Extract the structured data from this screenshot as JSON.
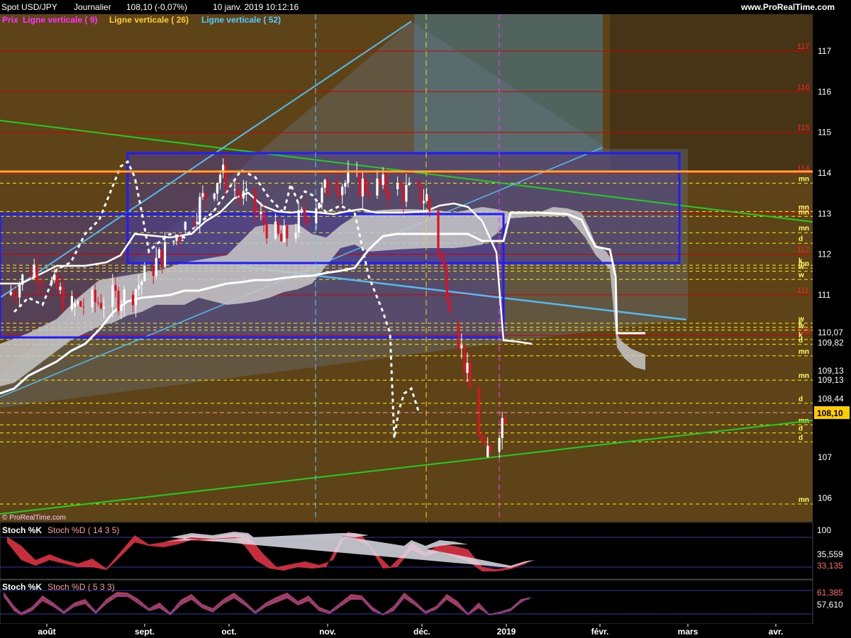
{
  "header": {
    "instrument": "Spot USD/JPY",
    "timeframe": "Journalier",
    "last_price": "108,10 (-0,07%)",
    "datetime": "10 janv. 2019 10:12:16",
    "site": "www.ProRealTime.com"
  },
  "legend": [
    {
      "label": "Prix",
      "color": "#ff33ff"
    },
    {
      "label": "Ligne verticale ( 9)",
      "color": "#ff33ff"
    },
    {
      "label": "Ligne verticale ( 26)",
      "color": "#ffcc33"
    },
    {
      "label": "Ligne verticale ( 52)",
      "color": "#55ccff"
    }
  ],
  "watermark": "© ProRealTime.com",
  "colors": {
    "background": "#000000",
    "chart_area": "#5e4318",
    "up_candle": "#ffffff",
    "down_candle": "#dd1122",
    "kumo": "#c8c8c8",
    "box": "#1d1dff",
    "trend_green": "#22cc22",
    "trend_blue": "#55bbee",
    "level_red": "#cc0000",
    "level_yellow": "#ffee00",
    "price_tag": "#ffcc00"
  },
  "chart_data": [
    {
      "type": "candlestick",
      "x_axis_labels": [
        "août",
        "sept.",
        "oct.",
        "nov.",
        "déc.",
        "2019",
        "févr.",
        "mars",
        "avr."
      ],
      "y_ticks": [
        {
          "label": "117",
          "value": 117
        },
        {
          "label": "116",
          "value": 116
        },
        {
          "label": "115",
          "value": 115
        },
        {
          "label": "114",
          "value": 114
        },
        {
          "label": "113",
          "value": 113
        },
        {
          "label": "112",
          "value": 112
        },
        {
          "label": "111",
          "value": 111
        },
        {
          "label": "110,07",
          "value": 110.07
        },
        {
          "label": "109,82",
          "value": 109.82
        },
        {
          "label": "109,13",
          "value": 109.13
        },
        {
          "label": "109,13",
          "value": 108.9
        },
        {
          "label": "108,44",
          "value": 108.44
        },
        {
          "label": "107",
          "value": 107
        },
        {
          "label": "106",
          "value": 106
        }
      ],
      "last_price": {
        "label": "108,10",
        "value": 108.1
      },
      "ylim": [
        105.6,
        117.9
      ],
      "red_levels": [
        {
          "value": 117,
          "label": "117"
        },
        {
          "value": 116,
          "label": "116"
        },
        {
          "value": 115,
          "label": "115"
        },
        {
          "value": 114,
          "label": "114"
        },
        {
          "value": 113,
          "label": "113"
        },
        {
          "value": 112,
          "label": "112"
        },
        {
          "value": 111,
          "label": "111"
        },
        {
          "value": 110,
          "label": "110"
        }
      ],
      "yellow_levels": [
        {
          "value": 113.75,
          "label": "mn"
        },
        {
          "value": 113.05,
          "label": "mn"
        },
        {
          "value": 112.93,
          "label": "mn"
        },
        {
          "value": 112.53,
          "label": "mn"
        },
        {
          "value": 112.27,
          "label": "d"
        },
        {
          "value": 111.73,
          "label": "k"
        },
        {
          "value": 111.66,
          "label": "mn"
        },
        {
          "value": 111.58,
          "label": "w"
        },
        {
          "value": 111.38,
          "label": "w"
        },
        {
          "value": 110.3,
          "label": "w"
        },
        {
          "value": 110.2,
          "label": "k"
        },
        {
          "value": 110.13,
          "label": "w"
        },
        {
          "value": 109.9,
          "label": "k"
        },
        {
          "value": 109.78,
          "label": "d"
        },
        {
          "value": 109.5,
          "label": "mn"
        },
        {
          "value": 108.9,
          "label": "mn"
        },
        {
          "value": 108.33,
          "label": "d"
        },
        {
          "value": 107.8,
          "label": "mn"
        },
        {
          "value": 107.6,
          "label": "d"
        },
        {
          "value": 107.38,
          "label": "d"
        },
        {
          "value": 105.85,
          "label": "mn"
        }
      ],
      "candles_sample_close": [
        {
          "date": "2018-07-23",
          "close": 111.0
        },
        {
          "date": "2018-08-01",
          "close": 111.7
        },
        {
          "date": "2018-08-14",
          "close": 110.7
        },
        {
          "date": "2018-09-03",
          "close": 111.0
        },
        {
          "date": "2018-09-21",
          "close": 112.6
        },
        {
          "date": "2018-10-04",
          "close": 114.0
        },
        {
          "date": "2018-10-25",
          "close": 112.3
        },
        {
          "date": "2018-11-12",
          "close": 113.8
        },
        {
          "date": "2018-12-03",
          "close": 113.6
        },
        {
          "date": "2018-12-14",
          "close": 113.4
        },
        {
          "date": "2018-12-24",
          "close": 110.3
        },
        {
          "date": "2019-01-03",
          "close": 107.0
        },
        {
          "date": "2019-01-10",
          "close": 108.1
        }
      ]
    },
    {
      "type": "line",
      "title": "Stoch %K",
      "title2": "Stoch %D ( 14 3 5)",
      "ylim": [
        0,
        100
      ],
      "y_ticks": [
        {
          "label": "100",
          "value": 100
        }
      ],
      "values": [
        {
          "label": "35,559",
          "value": 35.559
        },
        {
          "label": "33,135",
          "value": 33.135
        }
      ]
    },
    {
      "type": "line",
      "title": "Stoch %K",
      "title2": "Stoch %D ( 5 3 3)",
      "ylim": [
        0,
        100
      ],
      "values": [
        {
          "label": "61,385",
          "value": 61.385
        },
        {
          "label": "57,610",
          "value": 57.61
        }
      ]
    }
  ]
}
